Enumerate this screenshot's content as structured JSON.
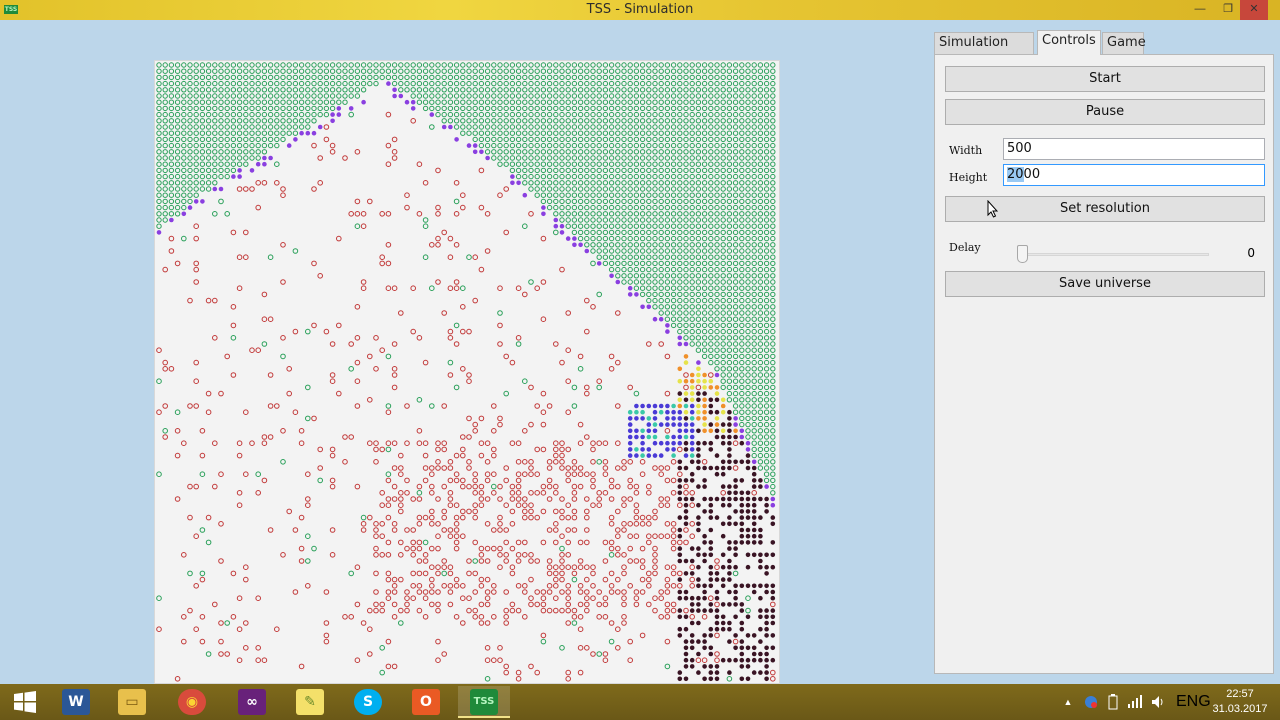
{
  "window": {
    "title": "TSS - Simulation",
    "app_icon_text": "TSS",
    "controls": {
      "minimize": "—",
      "maximize": "❐",
      "close": "✕"
    }
  },
  "tabs": [
    {
      "label": "Simulation info",
      "active": false
    },
    {
      "label": "Controls",
      "active": true
    },
    {
      "label": "Game",
      "active": false
    }
  ],
  "controls": {
    "start_label": "Start",
    "pause_label": "Pause",
    "width_label": "Width",
    "width_value": "500",
    "height_label": "Height",
    "height_value_selected": "20",
    "height_value_rest": "00",
    "set_resolution_label": "Set resolution",
    "delay_label": "Delay",
    "delay_value": "0",
    "save_universe_label": "Save universe"
  },
  "colors": {
    "green_cell": "#2aa05a",
    "violet_cell": "#8a3fe0",
    "red_cell": "#c23a3a",
    "dark_cell": "#3a1424",
    "blue_cell": "#4a3ad6",
    "teal_cell": "#3ac9a8",
    "orange_cell": "#f0902a",
    "yellow_cell": "#e6e34a"
  },
  "taskbar": {
    "apps": [
      {
        "name": "start",
        "icon": "windows-icon"
      },
      {
        "name": "word",
        "icon": "word-icon",
        "glyph": "W"
      },
      {
        "name": "explorer",
        "icon": "folder-icon",
        "glyph": "▭"
      },
      {
        "name": "chrome",
        "icon": "chrome-icon",
        "glyph": "◉"
      },
      {
        "name": "visual-studio",
        "icon": "visual-studio-icon",
        "glyph": "∞"
      },
      {
        "name": "notes",
        "icon": "note-icon",
        "glyph": "✎"
      },
      {
        "name": "skype",
        "icon": "skype-icon",
        "glyph": "S"
      },
      {
        "name": "office",
        "icon": "office-icon",
        "glyph": "O"
      },
      {
        "name": "tss",
        "icon": "tss-icon",
        "glyph": "TSS"
      }
    ],
    "tray": {
      "up_arrow": "▲",
      "language": "ENG",
      "time": "22:57",
      "date": "31.03.2017"
    }
  }
}
